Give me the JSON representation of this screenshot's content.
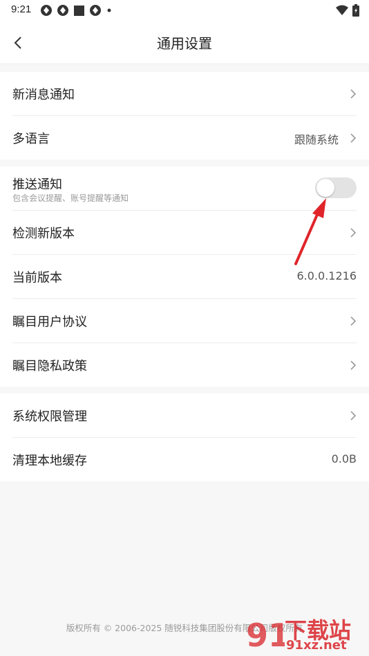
{
  "status_bar": {
    "time": "9:21",
    "icons": [
      "app-notification-icon",
      "app-notification-icon",
      "square-icon",
      "app-notification-icon",
      "dot-icon"
    ],
    "right_icons": [
      "wifi-icon",
      "battery-icon"
    ]
  },
  "header": {
    "title": "通用设置"
  },
  "groups": [
    {
      "items": [
        {
          "label": "新消息通知",
          "value": "",
          "arrow": true
        },
        {
          "label": "多语言",
          "value": "跟随系统",
          "arrow": true
        }
      ]
    },
    {
      "items": [
        {
          "label": "推送通知",
          "sub": "包含会议提醒、账号提醒等通知",
          "toggle": false
        },
        {
          "label": "检测新版本",
          "value": "",
          "arrow": true
        },
        {
          "label": "当前版本",
          "value": "6.0.0.1216",
          "arrow": false
        },
        {
          "label": "瞩目用户协议",
          "value": "",
          "arrow": true
        },
        {
          "label": "瞩目隐私政策",
          "value": "",
          "arrow": true
        }
      ]
    },
    {
      "items": [
        {
          "label": "系统权限管理",
          "value": "",
          "arrow": true
        },
        {
          "label": "清理本地缓存",
          "value": "0.0B",
          "arrow": false
        }
      ]
    }
  ],
  "footer": {
    "copyright": "版权所有 © 2006-2025 随锐科技集团股份有限公司版权所有"
  },
  "watermark": {
    "main": "下载站",
    "sub": "91xz.net",
    "logo": "91"
  },
  "colors": {
    "annotation_arrow": "#e0252a",
    "toggle_off": "#e3e3e3",
    "watermark_red": "#d9262b"
  }
}
